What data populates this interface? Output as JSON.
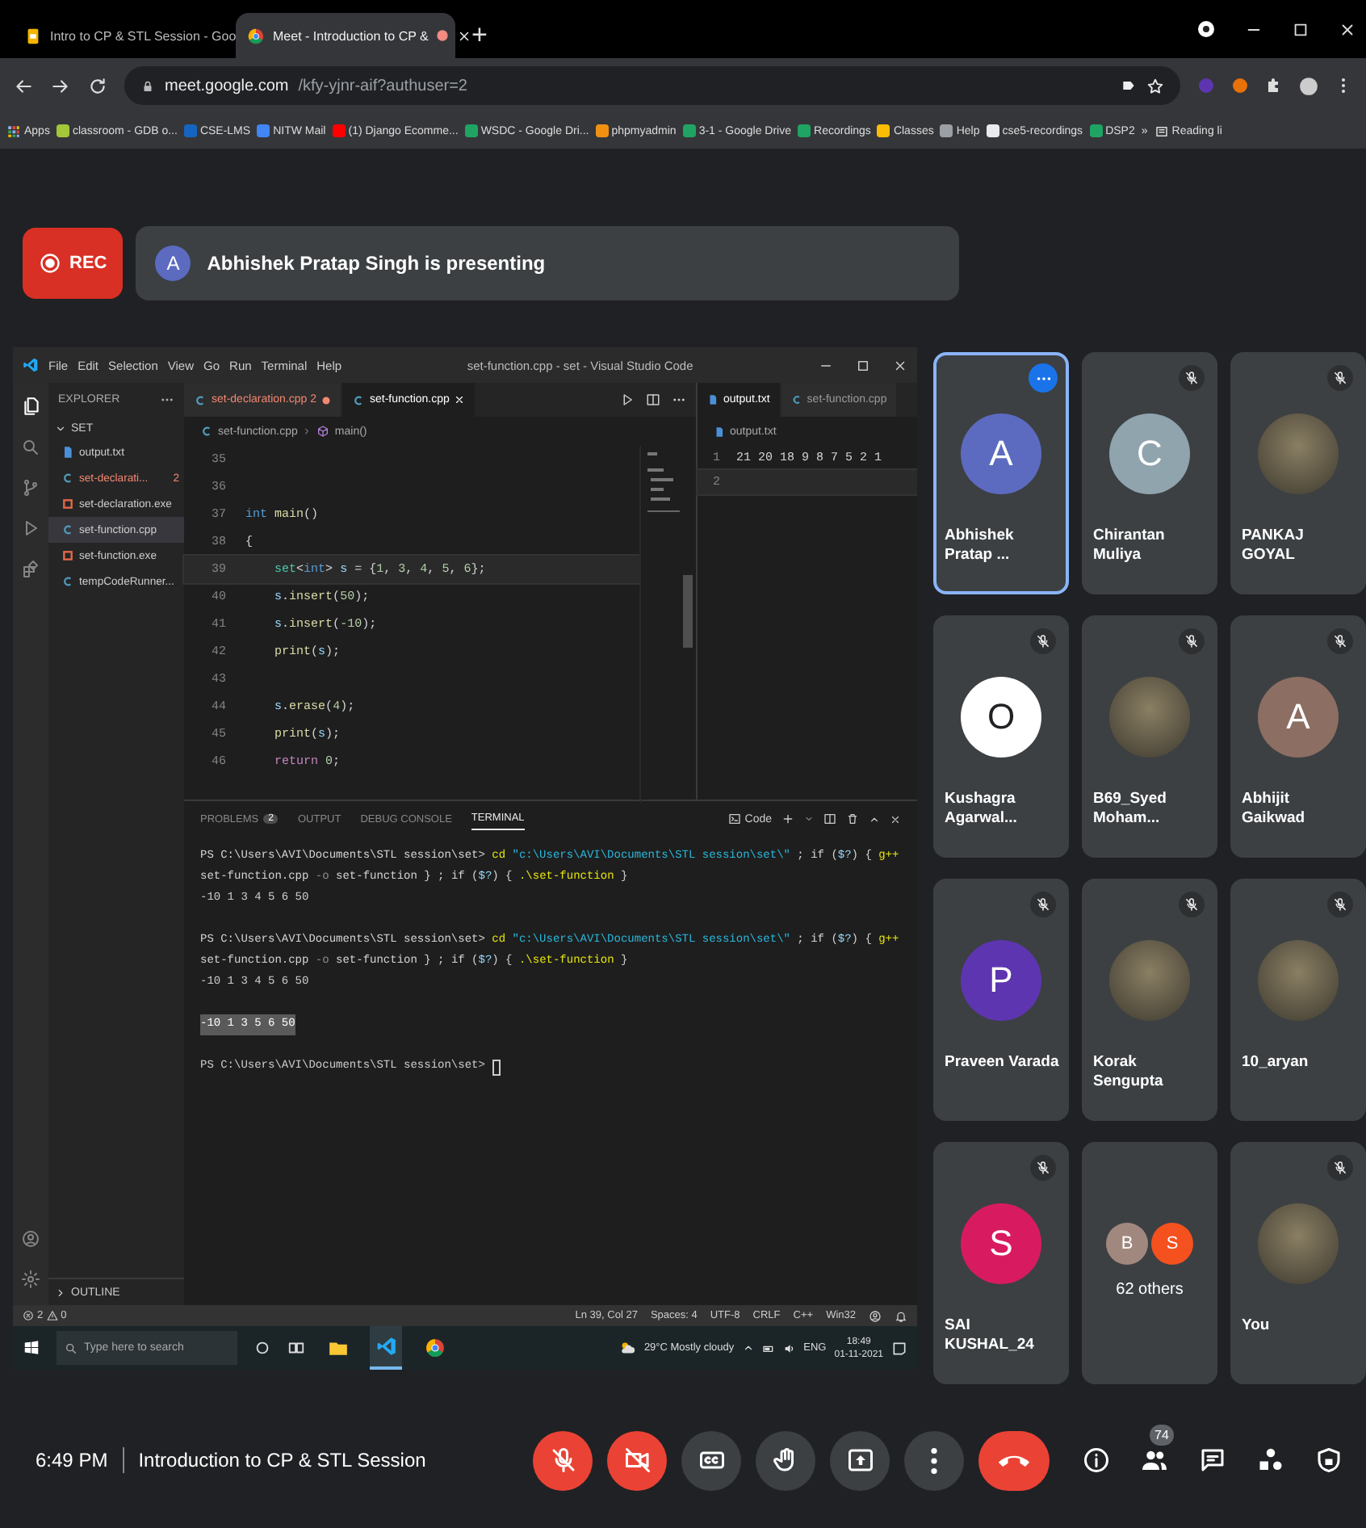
{
  "browser": {
    "tabs": [
      {
        "title": "Intro to CP & STL Session - Goo",
        "kind": "slides",
        "selected": false,
        "recording": false
      },
      {
        "title": "Meet - Introduction to CP &",
        "kind": "meet",
        "selected": true,
        "recording": true
      }
    ],
    "new_tab": "+",
    "url": {
      "host": "meet.google.com",
      "path": "/kfy-yjnr-aif?authuser=2"
    },
    "bookmarks": [
      {
        "label": "Apps",
        "kind": "apps"
      },
      {
        "label": "classroom - GDB o...",
        "kind": "site",
        "color": "#a4c639"
      },
      {
        "label": "CSE-LMS",
        "kind": "site",
        "color": "#1565c0"
      },
      {
        "label": "NITW Mail",
        "kind": "site",
        "color": "#4285f4"
      },
      {
        "label": "(1) Django Ecomme...",
        "kind": "site",
        "color": "#ff0000"
      },
      {
        "label": "WSDC - Google Dri...",
        "kind": "site",
        "color": "#1fa463"
      },
      {
        "label": "phpmyadmin",
        "kind": "site",
        "color": "#f29111"
      },
      {
        "label": "3-1 - Google Drive",
        "kind": "site",
        "color": "#1fa463"
      },
      {
        "label": "Recordings",
        "kind": "site",
        "color": "#1fa463"
      },
      {
        "label": "Classes",
        "kind": "site",
        "color": "#fbbc04"
      },
      {
        "label": "Help",
        "kind": "site",
        "color": "#9aa0a6"
      },
      {
        "label": "cse5-recordings",
        "kind": "site",
        "color": "#e8eaed"
      },
      {
        "label": "DSP2",
        "kind": "site",
        "color": "#1fa463"
      }
    ],
    "more": "»",
    "reading_list": "Reading li"
  },
  "meet": {
    "rec": "REC",
    "presenter": {
      "initial": "A",
      "color": "#5c6bc0",
      "text": "Abhishek Pratap Singh is presenting"
    }
  },
  "vscode": {
    "menu": [
      "File",
      "Edit",
      "Selection",
      "View",
      "Go",
      "Run",
      "Terminal",
      "Help"
    ],
    "title": "set-function.cpp - set - Visual Studio Code",
    "explorer": {
      "header": "EXPLORER",
      "folder": "SET",
      "files": [
        {
          "name": "output.txt",
          "kind": "txt",
          "selected": false,
          "error": false
        },
        {
          "name": "set-declarati...",
          "kind": "cpp",
          "selected": false,
          "error": true,
          "badge": "2"
        },
        {
          "name": "set-declaration.exe",
          "kind": "exe",
          "selected": false,
          "error": false
        },
        {
          "name": "set-function.cpp",
          "kind": "cpp",
          "selected": true,
          "error": false
        },
        {
          "name": "set-function.exe",
          "kind": "exe",
          "selected": false,
          "error": false
        },
        {
          "name": "tempCodeRunner...",
          "kind": "cpp",
          "selected": false,
          "error": false
        }
      ],
      "outline": "OUTLINE"
    },
    "editor_tabs": [
      {
        "name": "set-declaration.cpp",
        "badge": "2",
        "error": true,
        "modified": true,
        "selected": false
      },
      {
        "name": "set-function.cpp",
        "error": false,
        "modified": false,
        "selected": true
      }
    ],
    "breadcrumb": {
      "file": "set-function.cpp",
      "symbol": "main()"
    },
    "code": [
      {
        "n": "35",
        "current": false
      },
      {
        "n": "36",
        "current": false
      },
      {
        "n": "37",
        "current": false,
        "indent": false,
        "tokens": [
          {
            "text": "int ",
            "kind": "kw"
          },
          {
            "text": "main",
            "kind": "fn"
          },
          {
            "text": "()",
            "kind": "p"
          }
        ]
      },
      {
        "n": "38",
        "current": false,
        "indent": false,
        "tokens": [
          {
            "text": "{",
            "kind": "p"
          }
        ]
      },
      {
        "n": "39",
        "current": true,
        "indent": true,
        "tokens": [
          {
            "text": "set",
            "kind": "type"
          },
          {
            "text": "<",
            "kind": "p"
          },
          {
            "text": "int",
            "kind": "kw"
          },
          {
            "text": "> ",
            "kind": "p"
          },
          {
            "text": "s",
            "kind": "var"
          },
          {
            "text": " = {",
            "kind": "p"
          },
          {
            "text": "1",
            "kind": "num"
          },
          {
            "text": ", ",
            "kind": "p"
          },
          {
            "text": "3",
            "kind": "num"
          },
          {
            "text": ", ",
            "kind": "p"
          },
          {
            "text": "4",
            "kind": "num"
          },
          {
            "text": ", ",
            "kind": "p"
          },
          {
            "text": "5",
            "kind": "num"
          },
          {
            "text": ", ",
            "kind": "p"
          },
          {
            "text": "6",
            "kind": "num"
          },
          {
            "text": "};",
            "kind": "p"
          }
        ]
      },
      {
        "n": "40",
        "current": false,
        "indent": true,
        "tokens": [
          {
            "text": "s",
            "kind": "var"
          },
          {
            "text": ".",
            "kind": "p"
          },
          {
            "text": "insert",
            "kind": "fn"
          },
          {
            "text": "(",
            "kind": "p"
          },
          {
            "text": "50",
            "kind": "num"
          },
          {
            "text": ");",
            "kind": "p"
          }
        ]
      },
      {
        "n": "41",
        "current": false,
        "indent": true,
        "tokens": [
          {
            "text": "s",
            "kind": "var"
          },
          {
            "text": ".",
            "kind": "p"
          },
          {
            "text": "insert",
            "kind": "fn"
          },
          {
            "text": "(",
            "kind": "p"
          },
          {
            "text": "-10",
            "kind": "num"
          },
          {
            "text": ");",
            "kind": "p"
          }
        ]
      },
      {
        "n": "42",
        "current": false,
        "indent": true,
        "tokens": [
          {
            "text": "print",
            "kind": "fn"
          },
          {
            "text": "(",
            "kind": "p"
          },
          {
            "text": "s",
            "kind": "var"
          },
          {
            "text": ");",
            "kind": "p"
          }
        ]
      },
      {
        "n": "43",
        "current": false
      },
      {
        "n": "44",
        "current": false,
        "indent": true,
        "tokens": [
          {
            "text": "s",
            "kind": "var"
          },
          {
            "text": ".",
            "kind": "p"
          },
          {
            "text": "erase",
            "kind": "fn"
          },
          {
            "text": "(",
            "kind": "p"
          },
          {
            "text": "4",
            "kind": "num"
          },
          {
            "text": ");",
            "kind": "p"
          }
        ]
      },
      {
        "n": "45",
        "current": false,
        "indent": true,
        "tokens": [
          {
            "text": "print",
            "kind": "fn"
          },
          {
            "text": "(",
            "kind": "p"
          },
          {
            "text": "s",
            "kind": "var"
          },
          {
            "text": ");",
            "kind": "p"
          }
        ]
      },
      {
        "n": "46",
        "current": false,
        "indent": true,
        "tokens": [
          {
            "text": "return ",
            "kind": "ctl"
          },
          {
            "text": "0",
            "kind": "num"
          },
          {
            "text": ";",
            "kind": "p"
          }
        ]
      }
    ],
    "output_group": {
      "tabs": [
        {
          "name": "output.txt",
          "selected": true
        },
        {
          "name": "set-function.cpp",
          "selected": false
        }
      ],
      "breadcrumb": "output.txt",
      "lines": [
        {
          "n": "1",
          "text": "21 20 18 9 8 7 5 2 1",
          "current": false
        },
        {
          "n": "2",
          "current": true
        }
      ]
    },
    "panel": {
      "tabs": [
        {
          "label": "PROBLEMS",
          "badge": "2",
          "selected": false
        },
        {
          "label": "OUTPUT",
          "selected": false
        },
        {
          "label": "DEBUG CONSOLE",
          "selected": false
        },
        {
          "label": "TERMINAL",
          "selected": true
        }
      ],
      "terminal_name": "Code",
      "lines": [
        {
          "kind": "command",
          "tokens": [
            {
              "text": "PS C:\\Users\\AVI\\Documents\\STL session\\set> ",
              "kind": "p"
            },
            {
              "text": "cd ",
              "kind": "cmd"
            },
            {
              "text": "\"c:\\Users\\AVI\\Documents\\STL session\\set\\\"",
              "kind": "tstr"
            },
            {
              "text": " ; if (",
              "kind": "p"
            },
            {
              "text": "$?",
              "kind": "var"
            },
            {
              "text": ") { ",
              "kind": "p"
            },
            {
              "text": "g++",
              "kind": "cmd"
            },
            {
              "text": " set-function.cpp ",
              "kind": "p"
            },
            {
              "text": "-o",
              "kind": "param"
            },
            {
              "text": " set-function } ; if (",
              "kind": "p"
            },
            {
              "text": "$?",
              "kind": "var"
            },
            {
              "text": ") { ",
              "kind": "p"
            },
            {
              "text": ".\\set-function",
              "kind": "cmd"
            },
            {
              "text": " }",
              "kind": "p"
            }
          ]
        },
        {
          "kind": "output",
          "text": "-10 1 3 4 5 6 50"
        },
        {
          "kind": "command",
          "tokens": [
            {
              "text": "PS C:\\Users\\AVI\\Documents\\STL session\\set> ",
              "kind": "p"
            },
            {
              "text": "cd ",
              "kind": "cmd"
            },
            {
              "text": "\"c:\\Users\\AVI\\Documents\\STL session\\set\\\"",
              "kind": "tstr"
            },
            {
              "text": " ; if (",
              "kind": "p"
            },
            {
              "text": "$?",
              "kind": "var"
            },
            {
              "text": ") { ",
              "kind": "p"
            },
            {
              "text": "g++",
              "kind": "cmd"
            },
            {
              "text": " set-function.cpp ",
              "kind": "p"
            },
            {
              "text": "-o",
              "kind": "param"
            },
            {
              "text": " set-function } ; if (",
              "kind": "p"
            },
            {
              "text": "$?",
              "kind": "var"
            },
            {
              "text": ") { ",
              "kind": "p"
            },
            {
              "text": ".\\set-function",
              "kind": "cmd"
            },
            {
              "text": " }",
              "kind": "p"
            }
          ]
        },
        {
          "kind": "output",
          "text": "-10 1 3 4 5 6 50"
        },
        {
          "kind": "selected",
          "text": "-10 1 3 5 6 50"
        },
        {
          "kind": "prompt",
          "text": "PS C:\\Users\\AVI\\Documents\\STL session\\set> "
        }
      ]
    },
    "status": {
      "errors": "2",
      "warnings": "0",
      "items": [
        "Ln 39, Col 27",
        "Spaces: 4",
        "UTF-8",
        "CRLF",
        "C++",
        "Win32"
      ]
    },
    "taskbar": {
      "search_placeholder": "Type here to search",
      "weather": "29°C  Mostly cloudy",
      "lang": "ENG",
      "time": "18:49",
      "date": "01-11-2021"
    }
  },
  "participants": [
    {
      "kind": "person",
      "name": "Abhishek Pratap ...",
      "photo": false,
      "initial": "A",
      "color": "#5c6bc0",
      "muted": false,
      "highlighted": true
    },
    {
      "kind": "person",
      "name": "Chirantan Muliya",
      "photo": false,
      "initial": "C",
      "color": "#90a4ae",
      "muted": true,
      "highlighted": false
    },
    {
      "kind": "person",
      "name": "PANKAJ GOYAL",
      "photo": true,
      "muted": true,
      "highlighted": false
    },
    {
      "kind": "person",
      "name": "Kushagra Agarwal...",
      "photo": false,
      "initial": "O",
      "color": "#ffffff",
      "muted": true,
      "highlighted": false
    },
    {
      "kind": "person",
      "name": "B69_Syed Moham...",
      "photo": true,
      "muted": true,
      "highlighted": false
    },
    {
      "kind": "person",
      "name": "Abhijit Gaikwad",
      "photo": false,
      "initial": "A",
      "color": "#8d6e63",
      "muted": true,
      "highlighted": false
    },
    {
      "kind": "person",
      "name": "Praveen Varada",
      "photo": false,
      "initial": "P",
      "color": "#5e35b1",
      "muted": true,
      "highlighted": false
    },
    {
      "kind": "person",
      "name": "Korak Sengupta",
      "photo": true,
      "muted": true,
      "highlighted": false
    },
    {
      "kind": "person",
      "name": "10_aryan",
      "photo": true,
      "muted": true,
      "highlighted": false
    },
    {
      "kind": "person",
      "name": "SAI KUSHAL_24",
      "photo": false,
      "initial": "S",
      "color": "#d81b60",
      "muted": true,
      "highlighted": false
    },
    {
      "kind": "others",
      "label": "62 others",
      "avatars": [
        {
          "initial": "B",
          "color": "#a1887f"
        },
        {
          "initial": "S",
          "color": "#f4511e"
        }
      ]
    },
    {
      "kind": "person",
      "name": "You",
      "photo": true,
      "muted": true,
      "highlighted": false
    }
  ],
  "bottom_bar": {
    "time": "6:49 PM",
    "title": "Introduction to CP & STL Session",
    "controls": [
      {
        "kind": "mic",
        "off": true
      },
      {
        "kind": "camera",
        "off": true
      },
      {
        "kind": "captions",
        "off": false
      },
      {
        "kind": "hand",
        "off": false
      },
      {
        "kind": "present",
        "off": false
      },
      {
        "kind": "more",
        "off": false
      },
      {
        "kind": "end"
      }
    ],
    "people_count": "74"
  }
}
